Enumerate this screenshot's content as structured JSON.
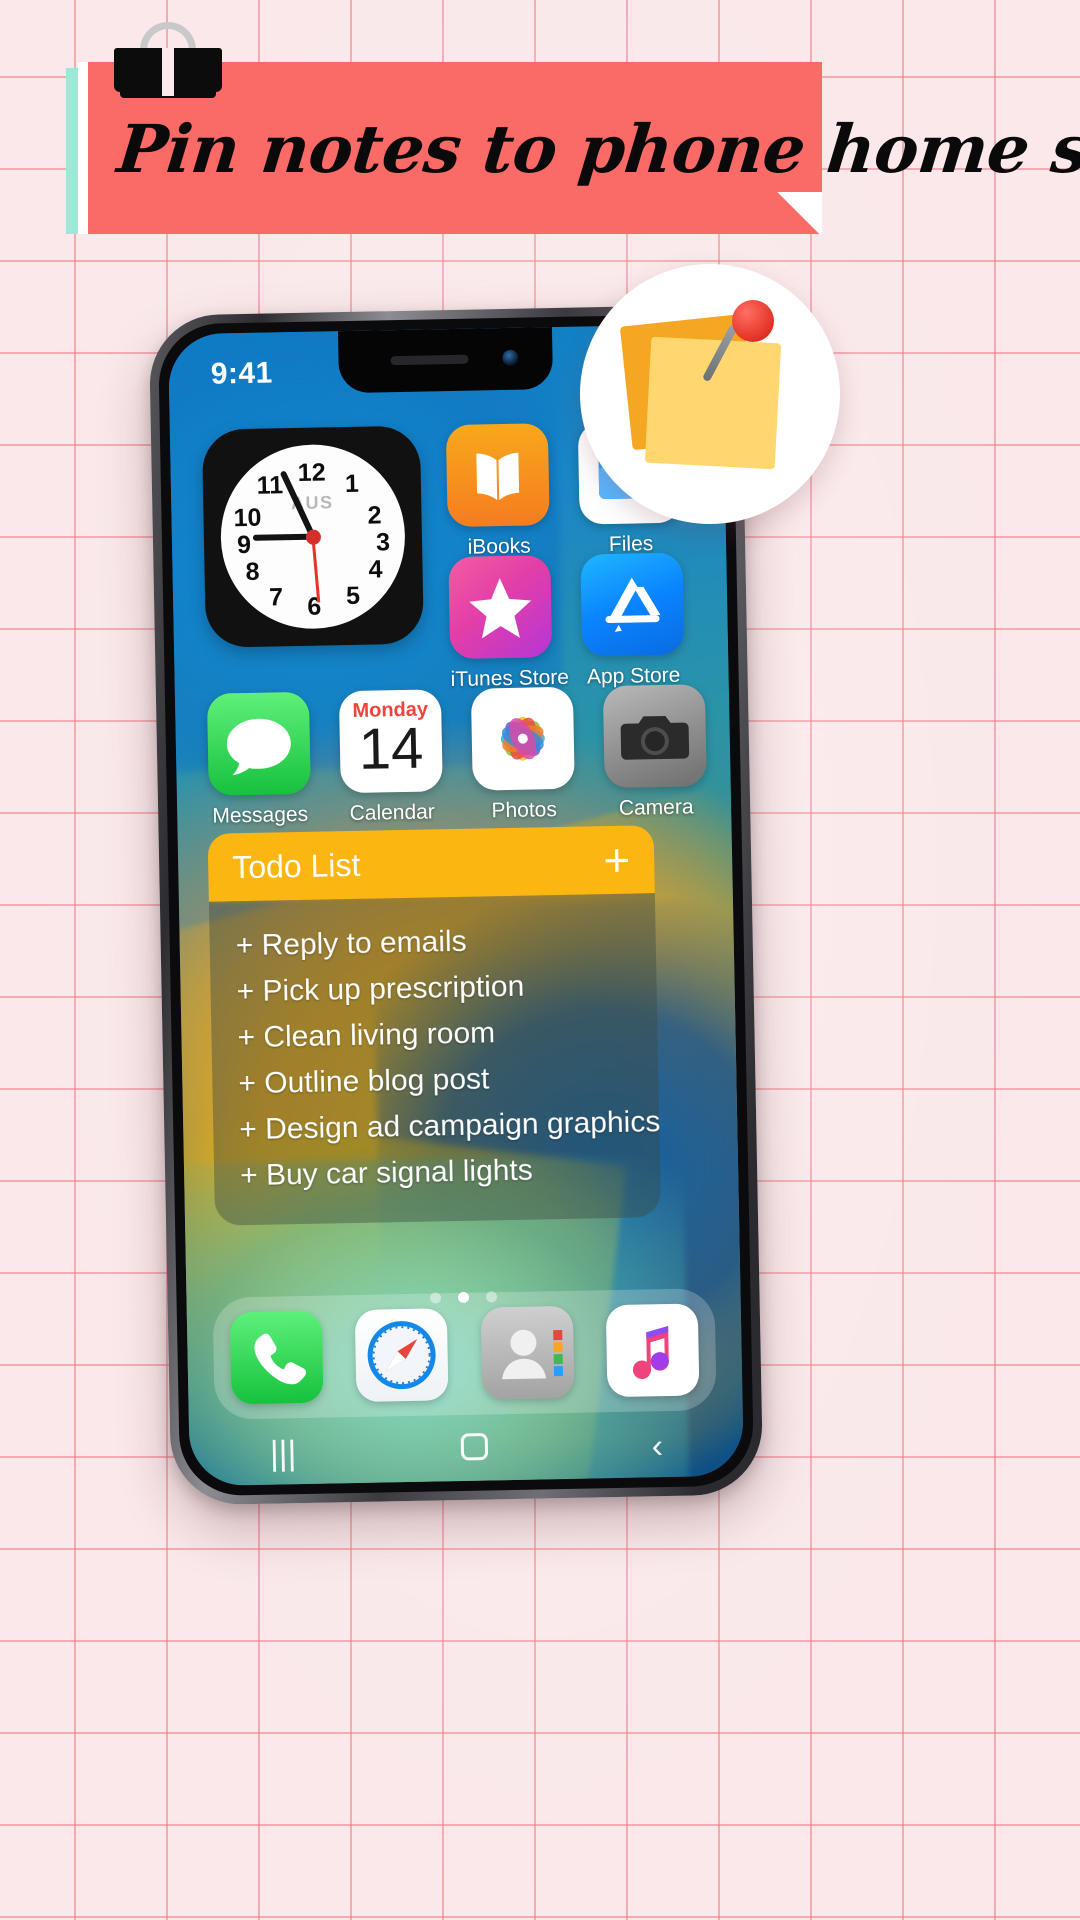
{
  "banner": {
    "title": "Pin notes to phone home screen",
    "color": "#fa6a67",
    "accent_mint": "#9fe8d6"
  },
  "clip": {
    "icon": "binder-clip-icon"
  },
  "callout": {
    "icon": "sticky-notes-pinned-icon",
    "note_back_color": "#f5a623",
    "note_front_color": "#ffd76e",
    "pin_color": "#e02d20"
  },
  "phone": {
    "statusbar": {
      "time": "9:41"
    },
    "clock_widget": {
      "region": "AUS",
      "numbers": [
        "12",
        "1",
        "2",
        "3",
        "4",
        "5",
        "6",
        "7",
        "8",
        "9",
        "10",
        "11"
      ],
      "hour_hand_color": "#131313",
      "second_hand_color": "#e4342a"
    },
    "apps_row1": [
      {
        "label": "iBooks",
        "icon": "ibooks-icon"
      },
      {
        "label": "Files",
        "icon": "files-icon"
      }
    ],
    "apps_row2": [
      {
        "label": "iTunes Store",
        "icon": "itunes-store-icon"
      },
      {
        "label": "App Store",
        "icon": "app-store-icon"
      }
    ],
    "apps_row3": [
      {
        "label": "Messages",
        "icon": "messages-icon"
      },
      {
        "label": "Calendar",
        "icon": "calendar-icon",
        "day": "Monday",
        "date": "14"
      },
      {
        "label": "Photos",
        "icon": "photos-icon"
      },
      {
        "label": "Camera",
        "icon": "camera-icon"
      }
    ],
    "todo_widget": {
      "title": "Todo List",
      "add_label": "+",
      "header_color": "#fbb611",
      "items": [
        "+ Reply to emails",
        "+ Pick up prescription",
        "+  Clean living room",
        "+ Outline blog post",
        "+ Design ad campaign graphics",
        "+ Buy car signal lights"
      ]
    },
    "page_dots": {
      "count": 3,
      "active_index": 1
    },
    "dock": [
      {
        "label": "Phone",
        "icon": "phone-icon"
      },
      {
        "label": "Safari",
        "icon": "safari-compass-icon"
      },
      {
        "label": "Contacts",
        "icon": "contacts-icon"
      },
      {
        "label": "Music",
        "icon": "music-note-icon"
      }
    ],
    "navbar": [
      {
        "label": "|||",
        "icon": "recents-icon"
      },
      {
        "label": "",
        "icon": "home-square-icon"
      },
      {
        "label": "‹",
        "icon": "back-chevron-icon"
      }
    ]
  }
}
